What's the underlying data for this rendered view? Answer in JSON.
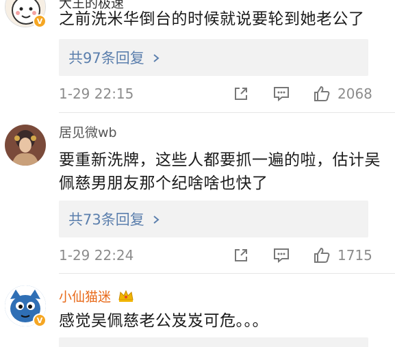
{
  "comments": [
    {
      "username": "大王的极速",
      "avatar": "cartoon-avatar",
      "verified": "V",
      "text": "之前洗米华倒台的时候就说要轮到她老公了",
      "replies_label": "共97条回复",
      "timestamp": "1-29 22:15",
      "like_count": "2068"
    },
    {
      "username": "居见微wb",
      "avatar": "portrait-avatar",
      "text": "要重新洗牌，这些人都要抓一遍的啦，估计吴佩慈男朋友那个纪啥啥也快了",
      "replies_label": "共73条回复",
      "timestamp": "1-29 22:24",
      "like_count": "1715"
    },
    {
      "username": "小仙猫迷",
      "avatar": "blue-cat-avatar",
      "verified": "V",
      "text": "感觉吴佩慈老公岌岌可危。。。"
    }
  ],
  "colors": {
    "link": "#5b7fad",
    "meta": "#8c8c8c",
    "reply_bg": "#f2f2f2",
    "verified": "#f5a623",
    "crown": "#f0b400"
  }
}
